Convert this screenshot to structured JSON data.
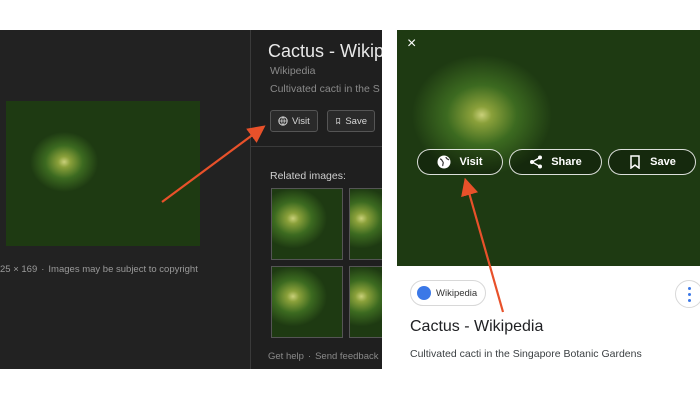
{
  "desktop": {
    "image_caption": {
      "dimensions": "25 × 169",
      "separator": "·",
      "copyright": "Images may be subject to copyright"
    },
    "title": "Cactus - Wikip",
    "source": "Wikipedia",
    "description": "Cultivated cacti in the S",
    "buttons": {
      "visit": "Visit",
      "save": "Save"
    },
    "related_label": "Related images:",
    "footer": {
      "help": "Get help",
      "separator": "·",
      "feedback": "Send feedback"
    }
  },
  "mobile": {
    "close": "×",
    "buttons": {
      "visit": "Visit",
      "share": "Share",
      "save": "Save"
    },
    "source_chip": "Wikipedia",
    "title": "Cactus - Wikipedia",
    "description": "Cultivated cacti in the Singapore Botanic Gardens"
  },
  "colors": {
    "arrow": "#e8512a",
    "dark_bg": "#222222",
    "chip_blue": "#3b78e7"
  }
}
